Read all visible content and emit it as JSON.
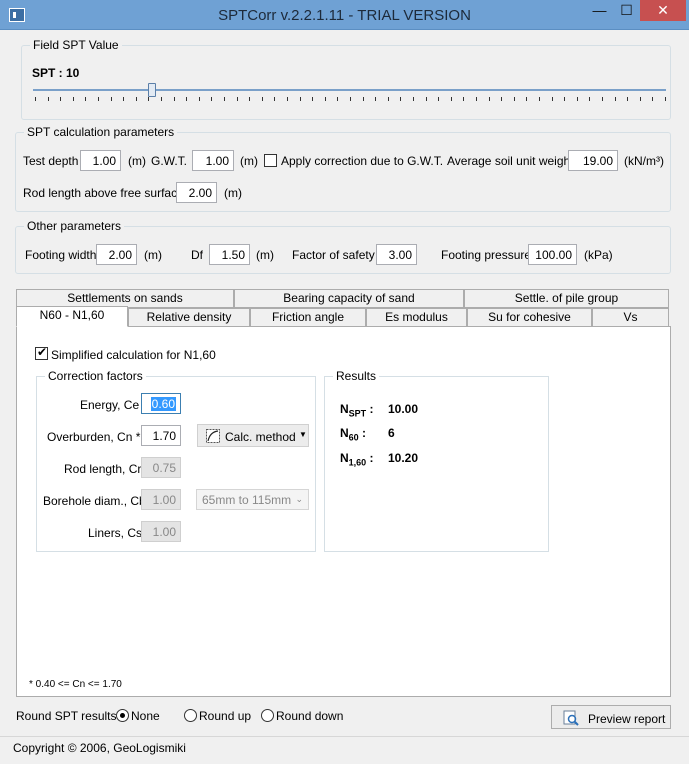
{
  "window": {
    "title": "SPTCorr v.2.2.1.11 - TRIAL VERSION",
    "min_glyph": "—",
    "max_glyph": "☐",
    "close_glyph": "✕"
  },
  "field_spt": {
    "group_title": "Field SPT Value",
    "label": "SPT : 10",
    "slider_value": 10
  },
  "spt_params": {
    "group_title": "SPT calculation parameters",
    "test_depth_label": "Test depth",
    "test_depth_value": "1.00",
    "test_depth_unit": "(m)",
    "gwt_label": "G.W.T.",
    "gwt_value": "1.00",
    "gwt_unit": "(m)",
    "apply_correction_label": "Apply correction due to G.W.T.",
    "apply_correction_checked": false,
    "avg_unit_weight_label": "Average soil unit weight",
    "avg_unit_weight_value": "19.00",
    "avg_unit_weight_unit": "(kN/m³)",
    "rod_length_label": "Rod length above free surface",
    "rod_length_value": "2.00",
    "rod_length_unit": "(m)"
  },
  "other_params": {
    "group_title": "Other parameters",
    "footing_width_label": "Footing width",
    "footing_width_value": "2.00",
    "footing_width_unit": "(m)",
    "df_label": "Df",
    "df_value": "1.50",
    "df_unit": "(m)",
    "fos_label": "Factor of safety",
    "fos_value": "3.00",
    "footing_pressure_label": "Footing pressure",
    "footing_pressure_value": "100.00",
    "footing_pressure_unit": "(kPa)"
  },
  "tabs": {
    "row1": [
      "Settlements on sands",
      "Bearing capacity of sand",
      "Settle. of pile group"
    ],
    "row2": [
      "N60 - N1,60",
      "Relative density",
      "Friction angle",
      "Es modulus",
      "Su for cohesive",
      "Vs"
    ],
    "active": "N60 - N1,60"
  },
  "n60_tab": {
    "simplified_label": "Simplified calculation for N1,60",
    "simplified_checked": true,
    "correction_group_title": "Correction factors",
    "energy_label": "Energy, Ce",
    "energy_value": "0.60",
    "overburden_label": "Overburden, Cn *",
    "overburden_value": "1.70",
    "calc_method_label": "Calc. method",
    "rod_length_label": "Rod length, Cr",
    "rod_length_value": "0.75",
    "borehole_label": "Borehole diam., Cb",
    "borehole_value": "1.00",
    "borehole_option": "65mm to 115mm",
    "liners_label": "Liners, Cs",
    "liners_value": "1.00",
    "results_group_title": "Results",
    "nspt_value": "10.00",
    "n60_value": "6",
    "n160_value": "10.20",
    "footnote": "* 0.40 <= Cn <= 1.70"
  },
  "bottom": {
    "round_label": "Round SPT results :",
    "round_options": [
      "None",
      "Round up",
      "Round down"
    ],
    "round_selected": "None",
    "preview_label": "Preview report",
    "copyright": "Copyright © 2006, GeoLogismiki"
  }
}
